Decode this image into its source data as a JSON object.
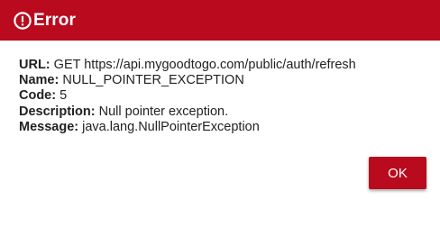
{
  "header": {
    "icon": "alert-circle-icon",
    "title": "Error"
  },
  "details": [
    {
      "key": "URL:",
      "value": "GET https://api.mygoodtogo.com/public/auth/refresh"
    },
    {
      "key": "Name:",
      "value": "NULL_POINTER_EXCEPTION"
    },
    {
      "key": "Code:",
      "value": "5"
    },
    {
      "key": "Description:",
      "value": "Null pointer exception."
    },
    {
      "key": "Message:",
      "value": "java.lang.NullPointerException"
    }
  ],
  "actions": {
    "ok_label": "OK"
  },
  "colors": {
    "header_bg": "#b90a1e",
    "button_bg": "#b90a1e",
    "text": "#222222"
  }
}
